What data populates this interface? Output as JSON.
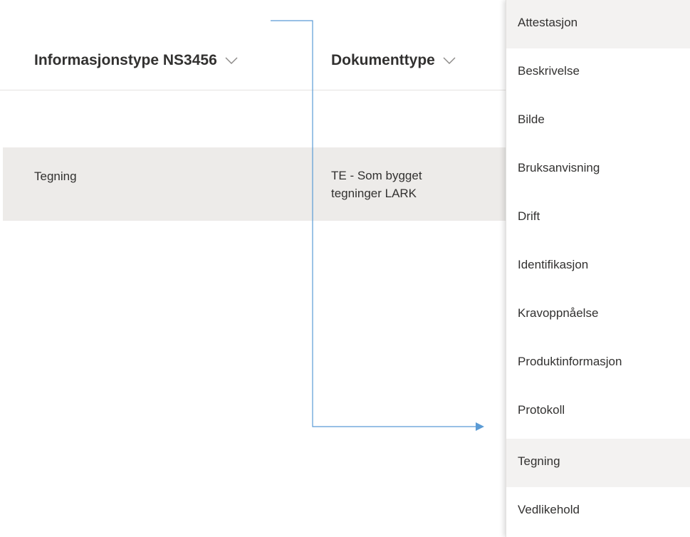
{
  "header": {
    "col_info": "Informasjonstype NS3456",
    "col_doc": "Dokumenttype"
  },
  "row": {
    "info": "Tegning",
    "doc_line1": "TE - Som bygget",
    "doc_line2": "tegninger LARK"
  },
  "dropdown": {
    "items": [
      "Attestasjon",
      "Beskrivelse",
      "Bilde",
      "Bruksanvisning",
      "Drift",
      "Identifikasjon",
      "Kravoppnåelse",
      "Produktinformasjon",
      "Protokoll",
      "Tegning",
      "Vedlikehold"
    ],
    "highlighted": [
      "Attestasjon",
      "Tegning"
    ]
  },
  "colors": {
    "arrow": "#5b9bd5",
    "row_bg": "#edebe9",
    "highlight_bg": "#f3f2f1"
  },
  "icons": [
    "chevron-down-icon",
    "arrow-annotation"
  ]
}
